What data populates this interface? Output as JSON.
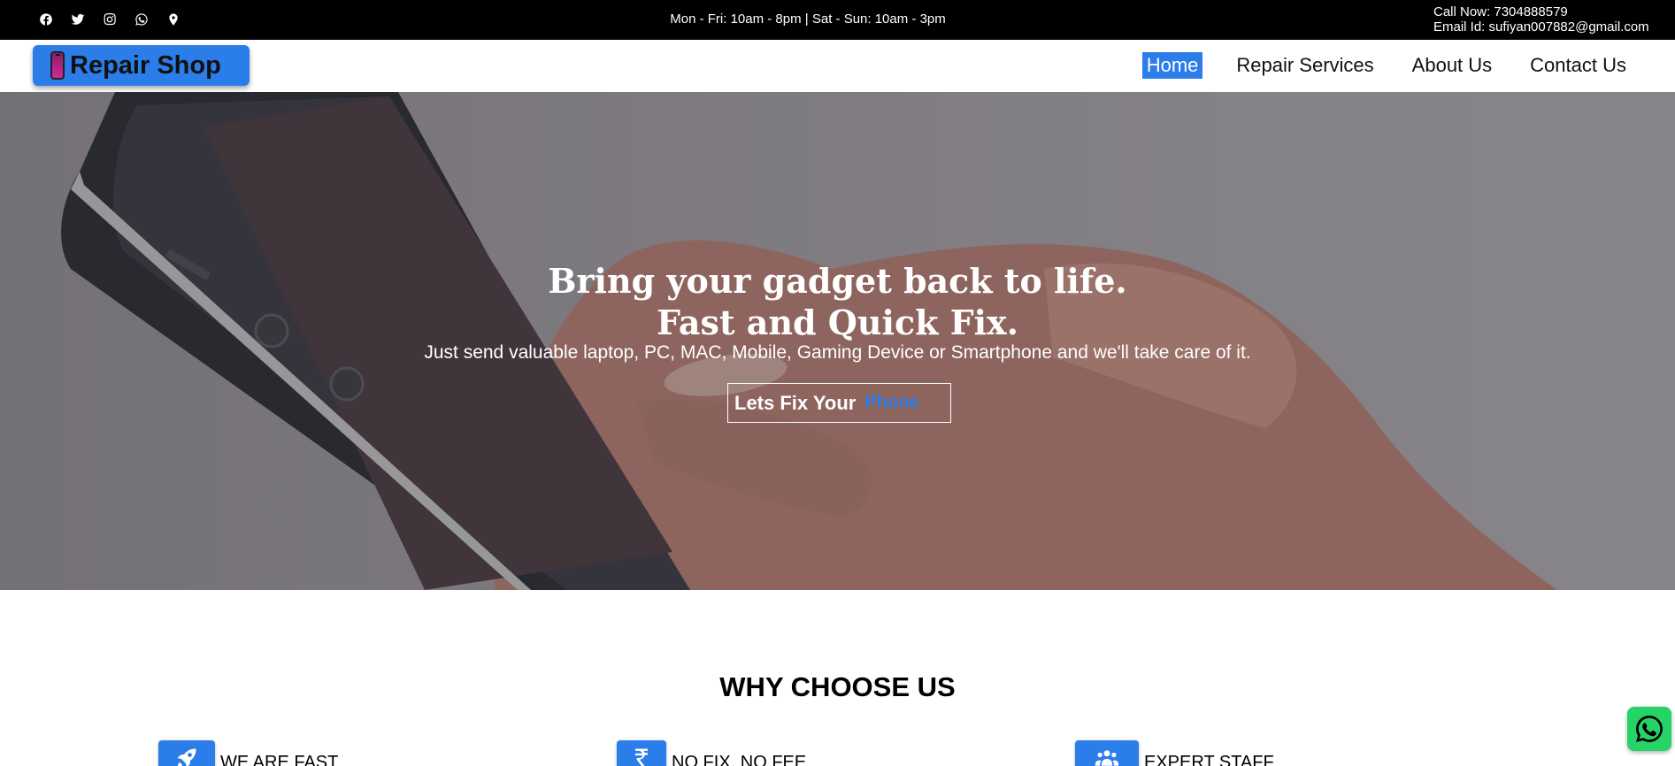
{
  "topbar": {
    "social_icons": [
      "facebook-icon",
      "twitter-icon",
      "instagram-icon",
      "whatsapp-icon",
      "location-pin-icon"
    ],
    "hours": "Mon - Fri: 10am - 8pm | Sat - Sun: 10am - 3pm",
    "call": "Call Now: 7304888579",
    "email": "Email Id: sufiyan007882@gmail.com"
  },
  "nav": {
    "logo_text": "Repair Shop",
    "items": [
      {
        "label": "Home",
        "active": true
      },
      {
        "label": "Repair Services",
        "active": false
      },
      {
        "label": "About Us",
        "active": false
      },
      {
        "label": "Contact Us",
        "active": false
      }
    ]
  },
  "hero": {
    "title_line1": "Bring your gadget back to life.",
    "title_line2": "Fast and Quick Fix.",
    "subtitle": "Just send valuable laptop, PC, MAC, Mobile, Gaming Device or Smartphone and we'll take care of it.",
    "cta_text": "Lets Fix Your",
    "cta_accent": "Phone"
  },
  "why": {
    "title": "WHY CHOOSE US",
    "features": [
      {
        "label": "WE ARE FAST",
        "icon": "rocket-icon"
      },
      {
        "label": "NO FIX, NO FEE",
        "icon": "rupee-icon"
      },
      {
        "label": "EXPERT STAFF",
        "icon": "users-icon"
      }
    ]
  },
  "colors": {
    "accent": "#2b7de9",
    "topbar_bg": "#000000",
    "whatsapp": "#25d366"
  }
}
